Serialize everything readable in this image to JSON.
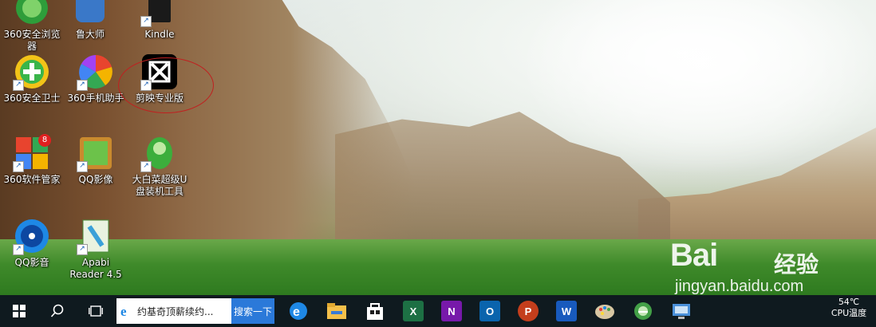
{
  "desktop_icons": [
    {
      "label": "360安全浏览器",
      "label_line1": "360安全浏览",
      "label_line2": "器",
      "icon": "360-browser-icon"
    },
    {
      "label": "鲁大师",
      "label_line1": "鲁大师",
      "label_line2": "",
      "icon": "ludashi-icon"
    },
    {
      "label": "Kindle",
      "label_line1": "Kindle",
      "label_line2": "",
      "icon": "kindle-icon"
    },
    {
      "label": "360安全卫士",
      "label_line1": "360安全卫士",
      "label_line2": "",
      "icon": "360-security-icon"
    },
    {
      "label": "360手机助手",
      "label_line1": "360手机助手",
      "label_line2": "",
      "icon": "360-phone-assistant-icon"
    },
    {
      "label": "剪映专业版",
      "label_line1": "剪映专业版",
      "label_line2": "",
      "icon": "capcut-icon"
    },
    {
      "label": "360软件管家",
      "label_line1": "360软件管家",
      "label_line2": "",
      "icon": "360-software-manager-icon",
      "badge": "8"
    },
    {
      "label": "QQ影像",
      "label_line1": "QQ影像",
      "label_line2": "",
      "icon": "qq-image-icon"
    },
    {
      "label": "大白菜超级U盘装机工具",
      "label_line1": "大白菜超级U",
      "label_line2": "盘装机工具",
      "icon": "dabaicai-icon"
    },
    {
      "label": "QQ影音",
      "label_line1": "QQ影音",
      "label_line2": "",
      "icon": "qq-player-icon"
    },
    {
      "label": "Apabi Reader 4.5",
      "label_line1": "Apabi",
      "label_line2": "Reader 4.5",
      "icon": "apabi-reader-icon"
    }
  ],
  "taskbar": {
    "search_text": "约基奇顶薪续约...",
    "search_button": "搜索一下",
    "pinned_apps": [
      {
        "name": "edge-icon"
      },
      {
        "name": "file-explorer-icon"
      },
      {
        "name": "microsoft-store-icon"
      },
      {
        "name": "excel-icon",
        "letter": "X",
        "color": "#1d7044"
      },
      {
        "name": "onenote-icon",
        "letter": "N",
        "color": "#7719aa"
      },
      {
        "name": "outlook-icon",
        "letter": "O",
        "color": "#0a64ad"
      },
      {
        "name": "powerpoint-icon",
        "letter": "P",
        "color": "#c43e1c"
      },
      {
        "name": "word-icon",
        "letter": "W",
        "color": "#185abd"
      },
      {
        "name": "paint-icon"
      },
      {
        "name": "360-browser-taskbar-icon"
      },
      {
        "name": "remote-desktop-icon"
      }
    ],
    "tray_temp": "54℃",
    "tray_label": "CPU温度"
  },
  "watermark": {
    "brand": "Bai",
    "brand_cn": "经验",
    "url": "jingyan.baidu.com"
  }
}
